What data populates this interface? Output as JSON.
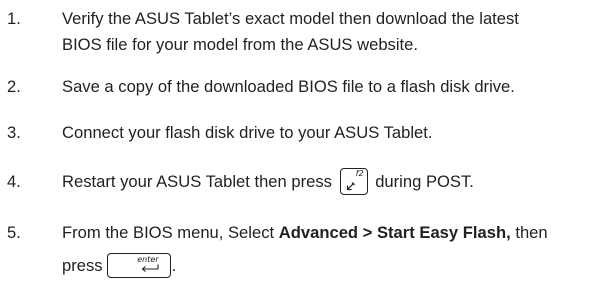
{
  "steps": [
    {
      "number": "1.",
      "line1": "Verify the ASUS Tablet’s exact model then download the latest",
      "line2": "BIOS file for your model from the ASUS website."
    },
    {
      "number": "2.",
      "text": "Save a copy of the downloaded BIOS file to a flash disk drive."
    },
    {
      "number": "3.",
      "text": "Connect your flash disk drive to your ASUS Tablet."
    },
    {
      "number": "4.",
      "before": "Restart your ASUS Tablet then press",
      "key_label": "f2",
      "after": "during POST."
    },
    {
      "number": "5.",
      "before": "From the BIOS menu, Select",
      "bold": "Advanced > Start Easy Flash,",
      "after": "then",
      "line2": "press",
      "key_label": "enter",
      "end": "."
    }
  ],
  "icons": {
    "f2_key_icon": "arrow-key-f2",
    "enter_key_icon": "return-arrow"
  }
}
